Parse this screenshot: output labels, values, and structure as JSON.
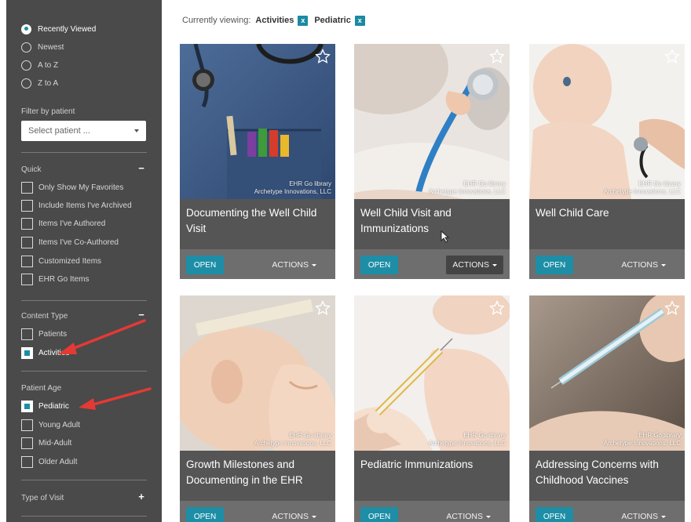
{
  "sort": {
    "options": [
      "Recently Viewed",
      "Newest",
      "A to Z",
      "Z to A"
    ],
    "selected": "Recently Viewed"
  },
  "filter_patient": {
    "label": "Filter by patient",
    "placeholder": "Select patient ..."
  },
  "quick": {
    "title": "Quick",
    "toggle": "−",
    "items": [
      "Only Show My Favorites",
      "Include Items I've Archived",
      "Items I've Authored",
      "Items I've Co-Authored",
      "Customized Items",
      "EHR Go Items"
    ]
  },
  "content_type": {
    "title": "Content Type",
    "toggle": "−",
    "items": [
      "Patients",
      "Activities"
    ],
    "checked": [
      "Activities"
    ]
  },
  "patient_age": {
    "title": "Patient Age",
    "items": [
      "Pediatric",
      "Young Adult",
      "Mid-Adult",
      "Older Adult"
    ],
    "checked": [
      "Pediatric"
    ]
  },
  "type_of_visit": {
    "title": "Type of Visit",
    "toggle": "+"
  },
  "viewing": {
    "label": "Currently viewing:",
    "chips": [
      "Activities",
      "Pediatric"
    ],
    "remove": "x"
  },
  "card_labels": {
    "open": "OPEN",
    "actions": "ACTIONS",
    "credit_line1": "EHR Go library",
    "credit_line2": "Archetype Innovations, LLC"
  },
  "cards": [
    {
      "title": "Documenting the Well Child Visit",
      "image": "scrubs-pocket-stethoscope"
    },
    {
      "title": "Well Child Visit and Immunizations",
      "image": "baby-hand-stethoscope"
    },
    {
      "title": "Well Child Care",
      "image": "baby-stethoscope-back"
    },
    {
      "title": "Growth Milestones and Documenting in the EHR",
      "image": "infant-head-measurement"
    },
    {
      "title": "Pediatric Immunizations",
      "image": "infant-leg-injection"
    },
    {
      "title": "Addressing Concerns with Childhood Vaccines",
      "image": "baby-vaccine-syringe"
    }
  ],
  "colors": {
    "sidebar": "#4a4a4a",
    "accent": "#1d8ea6",
    "card": "#555555",
    "card_footer": "#6e6e6e",
    "annotation_arrow": "#e53935"
  }
}
